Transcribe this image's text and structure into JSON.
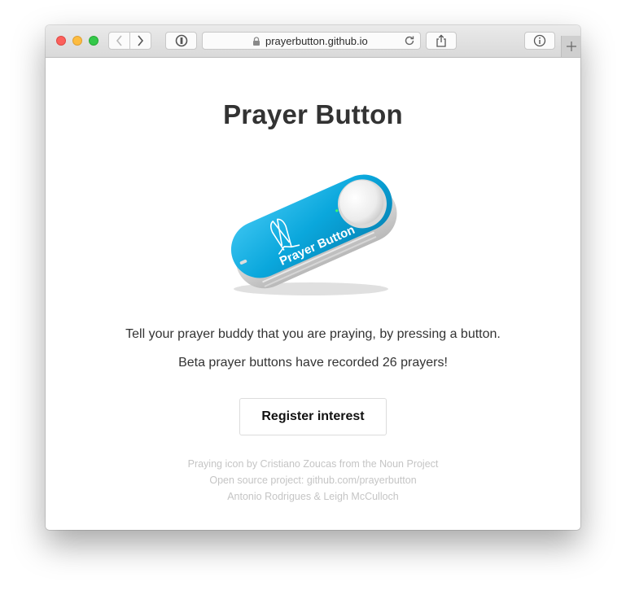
{
  "browser": {
    "url": "prayerbutton.github.io",
    "icons": {
      "back": "chevron-left-icon",
      "forward": "chevron-right-icon",
      "reader": "reader-icon",
      "lock": "lock-icon",
      "reload": "reload-icon",
      "share": "share-icon",
      "info": "info-icon",
      "new_tab": "plus-icon"
    }
  },
  "page": {
    "title": "Prayer Button",
    "device_label": "Prayer Button",
    "tagline": "Tell your prayer buddy that you are praying, by pressing a button.",
    "beta_text": "Beta prayer buttons have recorded 26 prayers!",
    "register_label": "Register interest",
    "credits": [
      "Praying icon by Cristiano Zoucas from the Noun Project",
      "Open source project: github.com/prayerbutton",
      "Antonio Rodrigues & Leigh McCulloch"
    ]
  },
  "colors": {
    "device_blue": "#0aa7dc",
    "text": "#333333",
    "credits": "#c5c5c5"
  }
}
